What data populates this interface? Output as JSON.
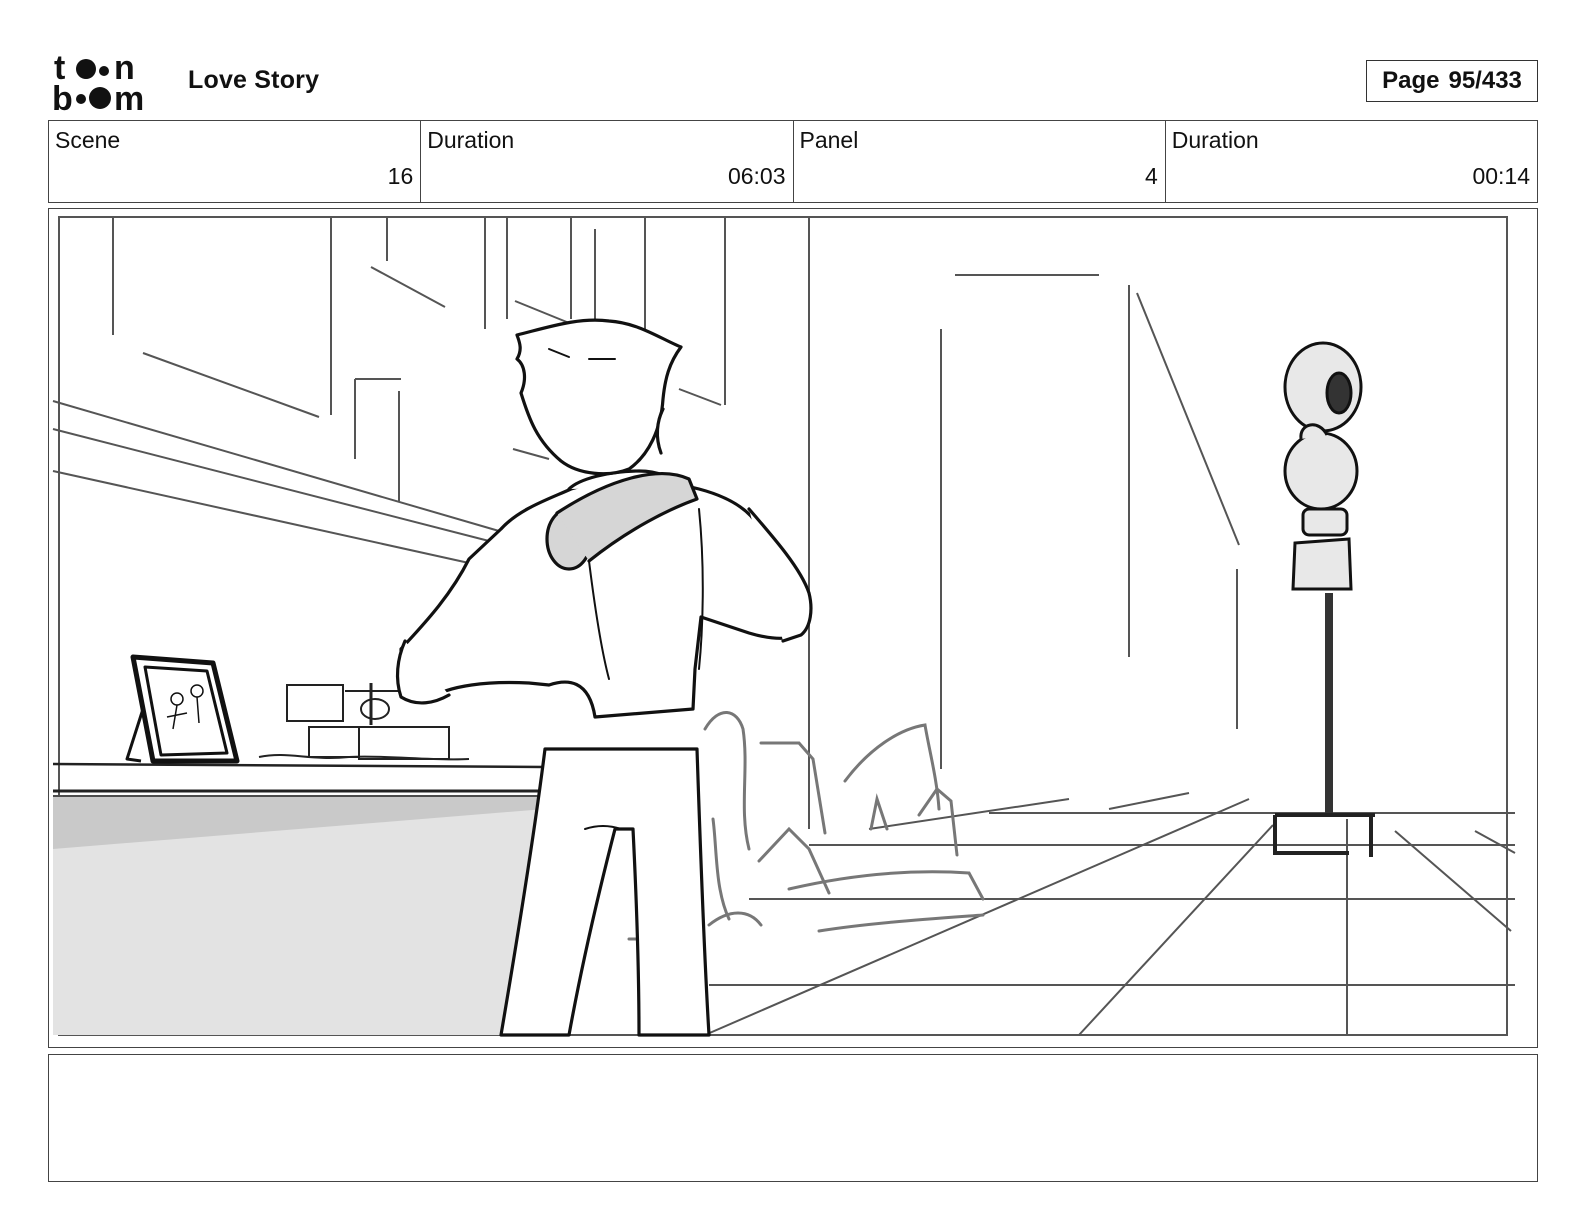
{
  "header": {
    "logo": {
      "text": "toon boom",
      "icon": "toon-boom-logo"
    },
    "title": "Love Story",
    "page": {
      "label": "Page",
      "value": "95/433"
    }
  },
  "info": [
    {
      "label": "Scene",
      "value": "16"
    },
    {
      "label": "Duration",
      "value": "06:03"
    },
    {
      "label": "Panel",
      "value": "4"
    },
    {
      "label": "Duration",
      "value": "00:14"
    }
  ],
  "panel": {
    "image": "storyboard-sketch"
  },
  "caption": {
    "text": ""
  }
}
